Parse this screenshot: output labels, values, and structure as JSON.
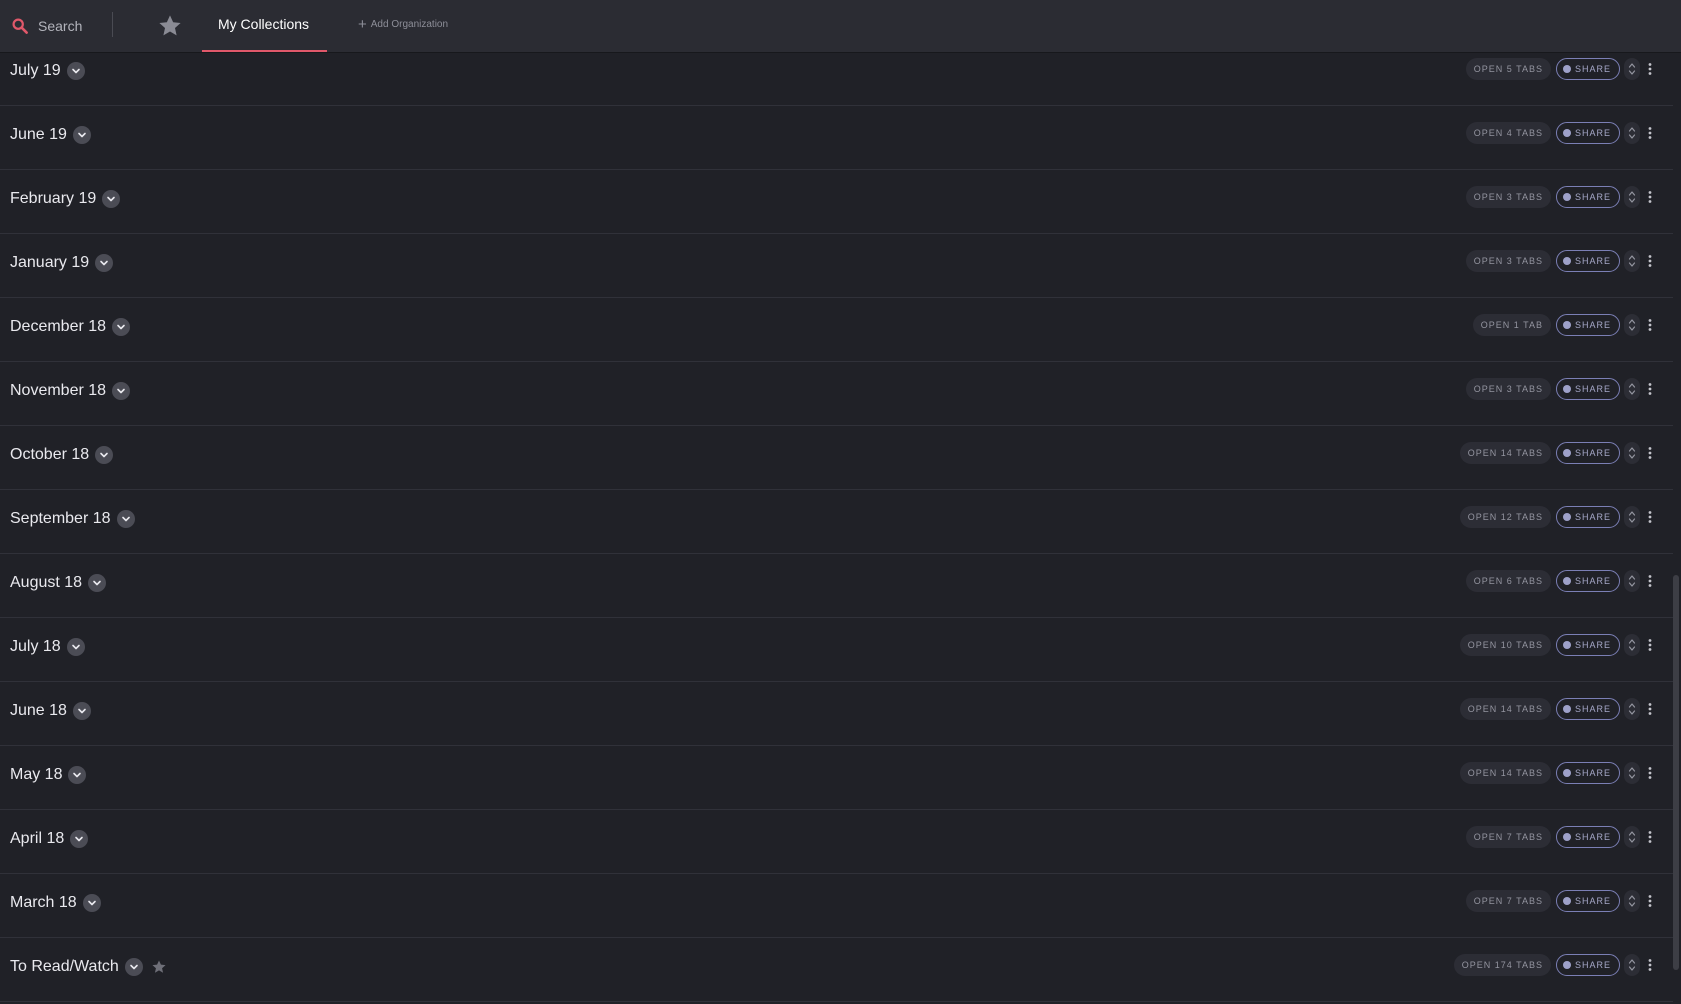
{
  "topbar": {
    "search_label": "Search",
    "active_tab_label": "My Collections",
    "add_org_label": "Add Organization"
  },
  "collections": [
    {
      "title": "July 19",
      "open_label": "OPEN 5 TABS",
      "share_label": "SHARE",
      "starred": false
    },
    {
      "title": "June 19",
      "open_label": "OPEN 4 TABS",
      "share_label": "SHARE",
      "starred": false
    },
    {
      "title": "February 19",
      "open_label": "OPEN 3 TABS",
      "share_label": "SHARE",
      "starred": false
    },
    {
      "title": "January 19",
      "open_label": "OPEN 3 TABS",
      "share_label": "SHARE",
      "starred": false
    },
    {
      "title": "December 18",
      "open_label": "OPEN 1 TAB",
      "share_label": "SHARE",
      "starred": false
    },
    {
      "title": "November 18",
      "open_label": "OPEN 3 TABS",
      "share_label": "SHARE",
      "starred": false
    },
    {
      "title": "October 18",
      "open_label": "OPEN 14 TABS",
      "share_label": "SHARE",
      "starred": false
    },
    {
      "title": "September 18",
      "open_label": "OPEN 12 TABS",
      "share_label": "SHARE",
      "starred": false
    },
    {
      "title": "August 18",
      "open_label": "OPEN 6 TABS",
      "share_label": "SHARE",
      "starred": false
    },
    {
      "title": "July 18",
      "open_label": "OPEN 10 TABS",
      "share_label": "SHARE",
      "starred": false
    },
    {
      "title": "June 18",
      "open_label": "OPEN 14 TABS",
      "share_label": "SHARE",
      "starred": false
    },
    {
      "title": "May 18",
      "open_label": "OPEN 14 TABS",
      "share_label": "SHARE",
      "starred": false
    },
    {
      "title": "April 18",
      "open_label": "OPEN 7 TABS",
      "share_label": "SHARE",
      "starred": false
    },
    {
      "title": "March 18",
      "open_label": "OPEN 7 TABS",
      "share_label": "SHARE",
      "starred": false
    },
    {
      "title": "To Read/Watch",
      "open_label": "OPEN 174 TABS",
      "share_label": "SHARE",
      "starred": true
    }
  ],
  "colors": {
    "background": "#202127",
    "topbar": "#2b2c33",
    "accent": "#e0586a",
    "share_border": "#7b7fb5"
  },
  "icons": {
    "search": "search-icon",
    "favorites": "star-icon",
    "add": "plus-icon",
    "expand": "chevron-down-icon",
    "sort": "sort-arrows-icon",
    "more": "more-vertical-icon"
  }
}
